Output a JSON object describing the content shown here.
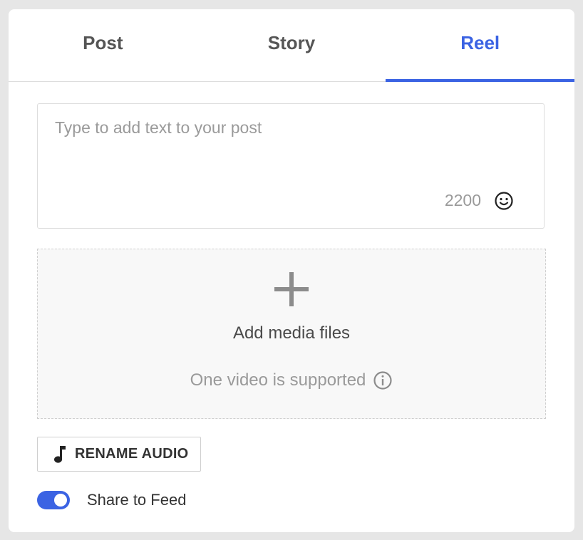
{
  "tabs": [
    {
      "label": "Post",
      "active": false
    },
    {
      "label": "Story",
      "active": false
    },
    {
      "label": "Reel",
      "active": true
    }
  ],
  "accent_color": "#3b63e3",
  "composer": {
    "placeholder": "Type to add text to your post",
    "value": "",
    "char_counter": "2200",
    "emoji_icon": "smiley-face-icon"
  },
  "media": {
    "plus_icon": "plus-icon",
    "title": "Add media files",
    "note": "One video is supported",
    "info_icon": "info-circle-icon"
  },
  "audio_button": {
    "icon": "music-note-icon",
    "label": "RENAME AUDIO"
  },
  "share_to_feed": {
    "label": "Share to Feed",
    "enabled": true
  }
}
